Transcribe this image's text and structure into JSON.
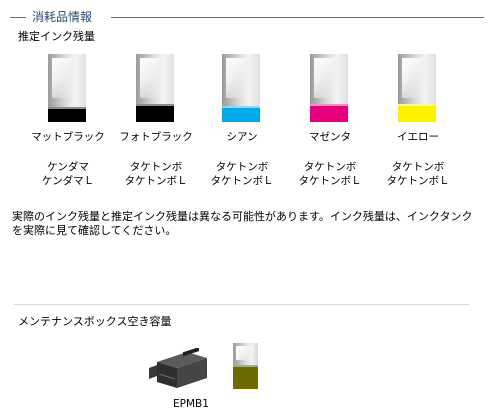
{
  "section": {
    "title": "消耗品情報"
  },
  "ink": {
    "heading": "推定インク残量",
    "colors": [
      {
        "name": "マットブラック",
        "cartridge1": "ケンダマ",
        "cartridge2": "ケンダマＬ",
        "color": "#000000",
        "level": 0.22
      },
      {
        "name": "フォトブラック",
        "cartridge1": "タケトンボ",
        "cartridge2": "タケトンボＬ",
        "color": "#000000",
        "level": 0.26
      },
      {
        "name": "シアン",
        "cartridge1": "タケトンボ",
        "cartridge2": "タケトンボＬ",
        "color": "#00a9e8",
        "level": 0.24
      },
      {
        "name": "マゼンタ",
        "cartridge1": "タケトンボ",
        "cartridge2": "タケトンボＬ",
        "color": "#e6007e",
        "level": 0.26
      },
      {
        "name": "イエロー",
        "cartridge1": "タケトンボ",
        "cartridge2": "タケトンボＬ",
        "color": "#fff000",
        "level": 0.26
      }
    ],
    "notice": "実際のインク残量と推定インク残量は異なる可能性があります。インク残量は、インクタンクを実際に見て確認してください。"
  },
  "maintenance": {
    "heading": "メンテナンスボックス空き容量",
    "model": "EPMB1",
    "fill_color": "#6b6b00",
    "level": 0.52
  }
}
